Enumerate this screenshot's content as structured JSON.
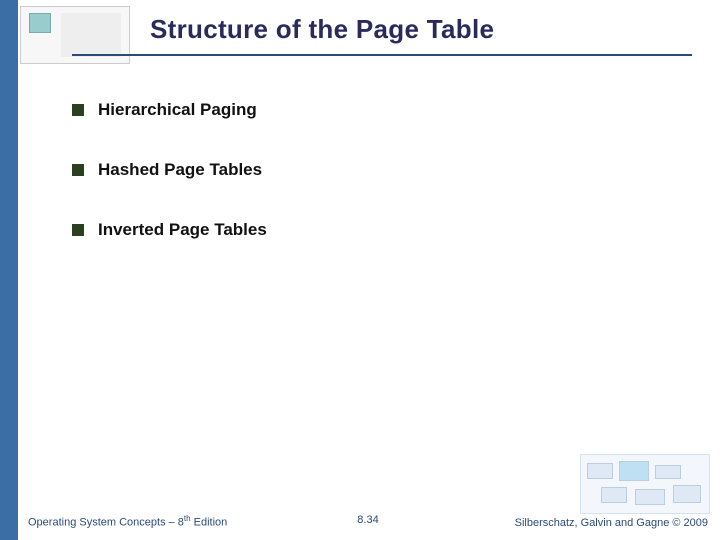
{
  "title": "Structure of the Page Table",
  "bullets": [
    {
      "text": "Hierarchical Paging"
    },
    {
      "text": "Hashed Page Tables"
    },
    {
      "text": "Inverted Page Tables"
    }
  ],
  "footer": {
    "book_prefix": "Operating System Concepts – 8",
    "book_suffix": " Edition",
    "page": "8.34",
    "credit": "Silberschatz, Galvin and Gagne © 2009"
  }
}
